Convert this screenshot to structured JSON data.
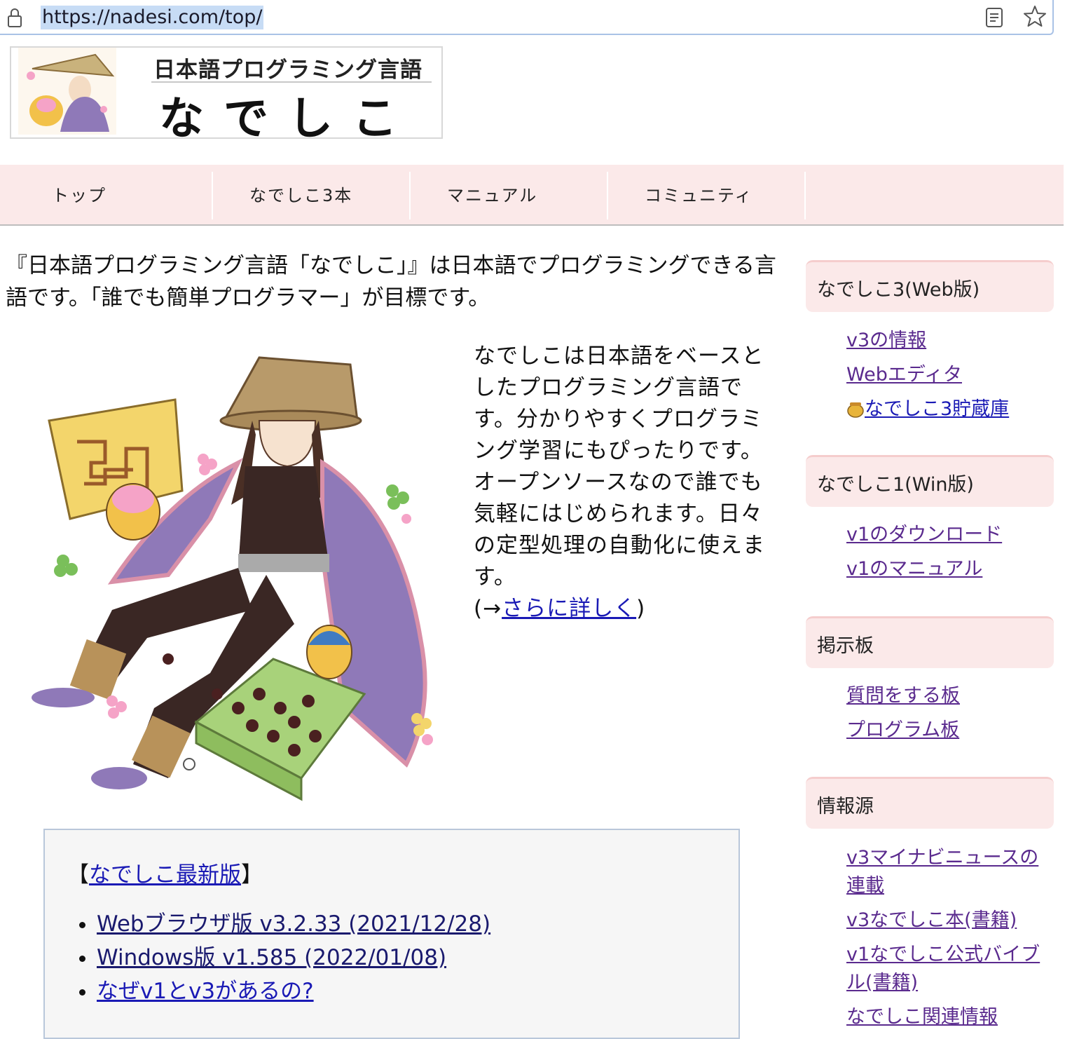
{
  "browser": {
    "url": "https://nadesi.com/top/",
    "icons": [
      "lock-icon",
      "reader-mode-icon",
      "bookmark-star-icon"
    ]
  },
  "logo": {
    "subtitle": "日本語プログラミング言語",
    "title": "なでしこ"
  },
  "nav": {
    "items": [
      "トップ",
      "なでしこ3本",
      "マニュアル",
      "コミュニティ"
    ]
  },
  "main": {
    "intro": "『日本語プログラミング言語「なでしこ」』は日本語でプログラミングできる言語です。「誰でも簡単プログラマー」が目標です。",
    "description": "なでしこは日本語をベースとしたプログラミング言語です。分かりやすくプログラミング学習にもぴったりです。オープンソースなので誰でも気軽にはじめられます。日々の定型処理の自動化に使えます。",
    "more_prefix": "(→",
    "more_link": "さらに詳しく",
    "more_suffix": ")"
  },
  "news": {
    "open_bracket": "【",
    "heading_link": "なでしこ最新版",
    "close_bracket": "】",
    "items": [
      "Webブラウザ版 v3.2.33 (2021/12/28)",
      "Windows版 v1.585 (2022/01/08)",
      "なぜv1とv3があるの?"
    ]
  },
  "sidebar": {
    "sections": [
      {
        "title": "なでしこ3(Web版)",
        "links": [
          "v3の情報",
          "Webエディタ",
          "なでしこ3貯蔵庫"
        ]
      },
      {
        "title": "なでしこ1(Win版)",
        "links": [
          "v1のダウンロード",
          "v1のマニュアル"
        ]
      },
      {
        "title": "掲示板",
        "links": [
          "質問をする板",
          "プログラム板"
        ]
      },
      {
        "title": "情報源",
        "links": [
          "v3マイナビニュースの連載",
          "v3なでしこ本(書籍)",
          "v1なでしこ公式バイブル(書籍)",
          "なでしこ関連情報"
        ]
      }
    ]
  },
  "colors": {
    "nav_bg": "#fbe9e9",
    "link": "#1a1ab5",
    "visited_link": "#5a2a8e",
    "url_selection": "#c7dcf5"
  }
}
